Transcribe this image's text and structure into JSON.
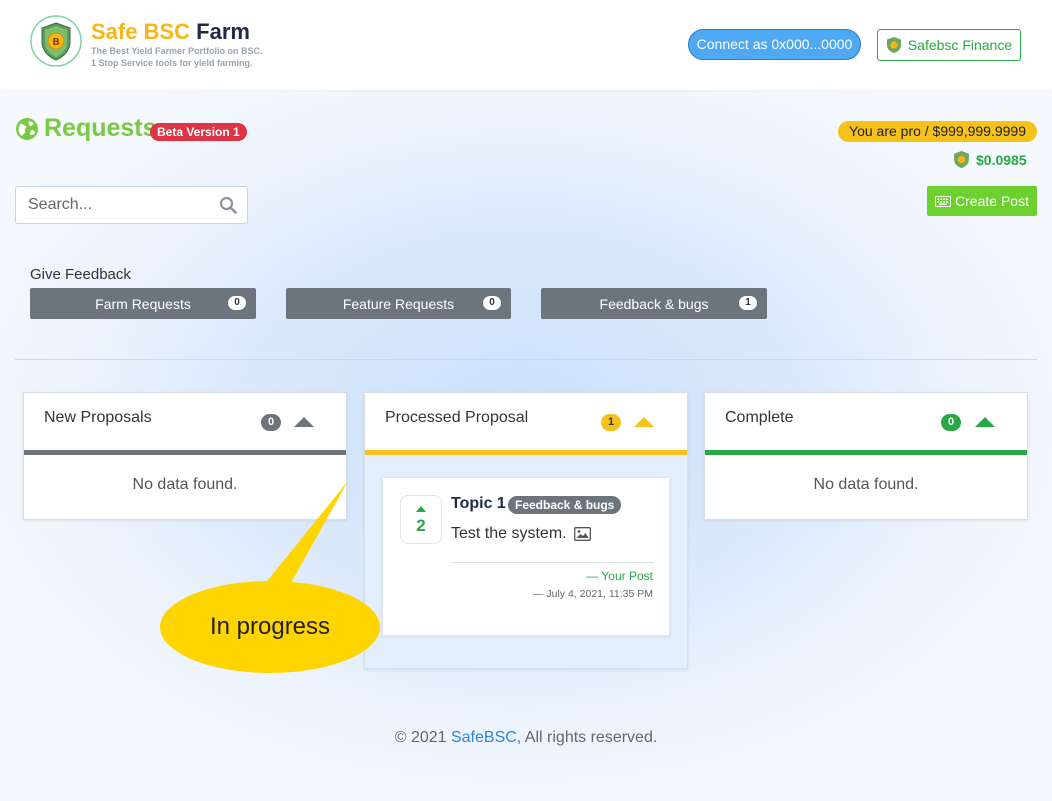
{
  "header": {
    "brand_part1": "Safe BSC",
    "brand_part2": "Farm",
    "tagline_1": "The Best Yield Farmer Portfolio on BSC.",
    "tagline_2": "1 Stop Service tools for yield farming.",
    "connect_label": "Connect as 0x000...0000",
    "finance_label": "Safebsc Finance",
    "logo_letter": "B"
  },
  "page": {
    "title": "Requests",
    "beta_badge": "Beta Version 1",
    "pro_badge": "You are pro / $999,999.9999",
    "price": "$0.0985",
    "search_placeholder": "Search...",
    "create_label": "Create Post"
  },
  "feedback": {
    "label": "Give Feedback",
    "categories": [
      {
        "label": "Farm Requests",
        "count": "0"
      },
      {
        "label": "Feature Requests",
        "count": "0"
      },
      {
        "label": "Feedback & bugs",
        "count": "1"
      }
    ]
  },
  "columns": [
    {
      "title": "New Proposals",
      "count": "0",
      "empty": "No data found.",
      "color": "#6c757d"
    },
    {
      "title": "Processed Proposal",
      "count": "1",
      "color": "#f6c21a"
    },
    {
      "title": "Complete",
      "count": "0",
      "empty": "No data found.",
      "color": "#28a745"
    }
  ],
  "post": {
    "votes": "2",
    "title": "Topic 1",
    "tag": "Feedback & bugs",
    "body": "Test the system.",
    "author": "— Your Post",
    "date": "— July 4, 2021, 11:35 PM"
  },
  "callout": {
    "text": "In progress",
    "color": "#ffd500"
  },
  "footer": {
    "prefix": "© 2021 ",
    "link": "SafeBSC",
    "suffix": ", All rights reserved."
  },
  "icons": {
    "logo": "shield-bitcoin-icon",
    "globe": "globe-icon",
    "search": "search-icon",
    "create": "keyboard-icon",
    "image": "image-icon",
    "caret": "caret-up-icon"
  }
}
